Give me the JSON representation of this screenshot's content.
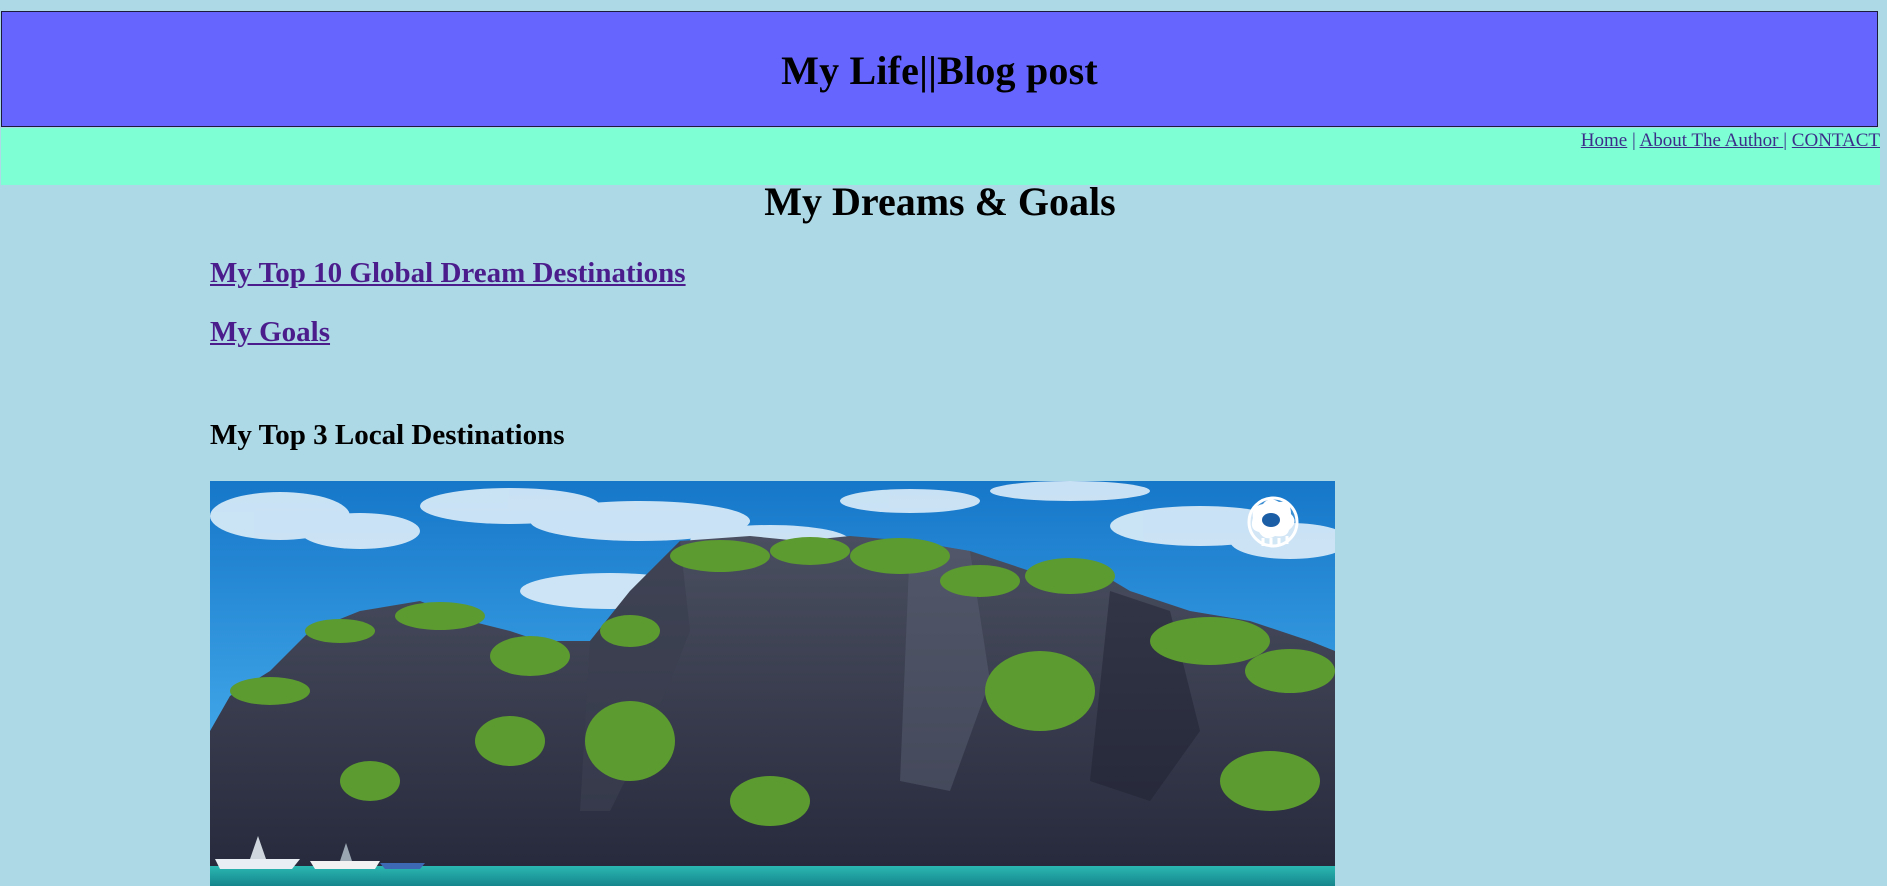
{
  "header": {
    "title": "My Life||Blog post"
  },
  "nav": {
    "links": [
      {
        "label": "Home"
      },
      {
        "label": "About The Author "
      },
      {
        "label": "CONTACT"
      }
    ],
    "separator": " | "
  },
  "page": {
    "heading": "My Dreams & Goals"
  },
  "content": {
    "links": [
      {
        "label": "My Top 10 Global Dream Destinations"
      },
      {
        "label": "My Goals"
      }
    ],
    "section_heading": "My Top 3 Local Destinations",
    "photo": {
      "subject": "limestone cliffs over turquoise water with boats",
      "watermark_icon": "sheep-logo-icon"
    }
  },
  "colors": {
    "page_background": "#add8e6",
    "header_background": "#6666ff",
    "nav_background": "#7fffd4",
    "link_color": "#4b1d8c"
  }
}
